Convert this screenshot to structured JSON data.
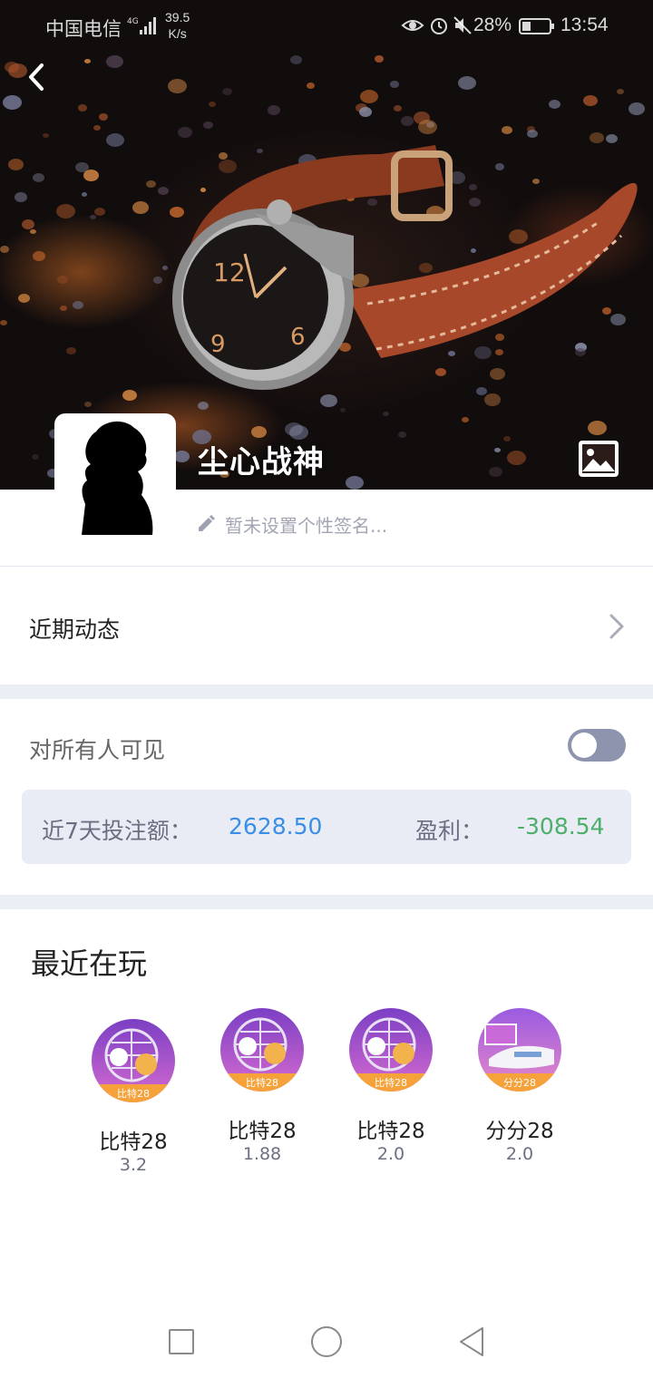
{
  "status_bar": {
    "carrier": "中国电信",
    "network_type": "4G",
    "speed_value": "39.5",
    "speed_unit": "K/s",
    "battery": "28%",
    "time": "13:54",
    "icons": [
      "signal-icon",
      "eye-icon",
      "alarm-icon",
      "mute-icon",
      "battery-icon"
    ]
  },
  "header": {
    "back_icon": "chevron-left-icon",
    "username": "尘心战神",
    "gallery_icon": "image-icon"
  },
  "profile": {
    "signature_placeholder": "暂未设置个性签名..."
  },
  "activity": {
    "label": "近期动态"
  },
  "visibility": {
    "label": "对所有人可见",
    "enabled": false
  },
  "stats": {
    "bet_label": "近7天投注额：",
    "bet_value": "2628.50",
    "profit_label": "盈利：",
    "profit_value": "-308.54",
    "bet_color": "#3a8ee6",
    "profit_color": "#4caf6a"
  },
  "recent_games": {
    "title": "最近在玩",
    "items": [
      {
        "name": "比特28",
        "odds": "3.2",
        "badge": "比特28"
      },
      {
        "name": "比特28",
        "odds": "1.88",
        "badge": "比特28"
      },
      {
        "name": "比特28",
        "odds": "2.0",
        "badge": "比特28"
      },
      {
        "name": "分分28",
        "odds": "2.0",
        "badge": "分分28"
      }
    ]
  },
  "nav_bar": {
    "icons": [
      "recent-apps-icon",
      "home-icon",
      "back-icon"
    ]
  }
}
